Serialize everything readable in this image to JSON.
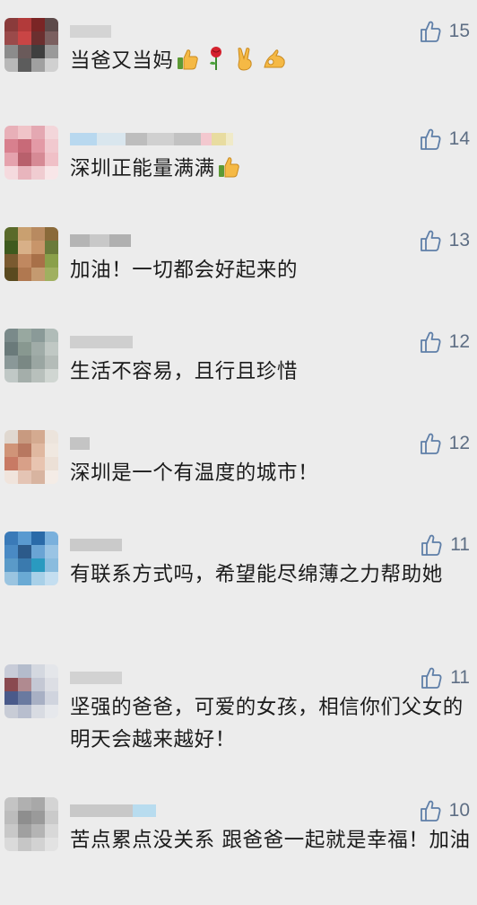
{
  "comments": [
    {
      "text": "当爸又当妈",
      "likes": "15"
    },
    {
      "text": "深圳正能量满满",
      "likes": "14"
    },
    {
      "text": "加油！一切都会好起来的",
      "likes": "13"
    },
    {
      "text": "生活不容易，且行且珍惜",
      "likes": "12"
    },
    {
      "text": "深圳是一个有温度的城市！",
      "likes": "12"
    },
    {
      "text": "有联系方式吗，希望能尽绵薄之力帮助她",
      "likes": "11"
    },
    {
      "text": "坚强的爸爸，可爱的女孩，相信你们父女的明天会越来越好！",
      "likes": "11"
    },
    {
      "text": "苦点累点没关系 跟爸爸一起就是幸福！加油",
      "likes": "10"
    }
  ],
  "icons": {
    "like": "thumbs-up-outline-icon",
    "thumbs_up_emoji": "thumbs-up-emoji-icon",
    "rose_emoji": "rose-emoji-icon",
    "victory_emoji": "victory-hand-emoji-icon",
    "ok_emoji": "ok-hand-emoji-icon"
  },
  "colors": {
    "background": "#ececec",
    "like_icon": "#5f7fa8",
    "like_count": "#5e6e84",
    "text": "#1b1b1b"
  }
}
